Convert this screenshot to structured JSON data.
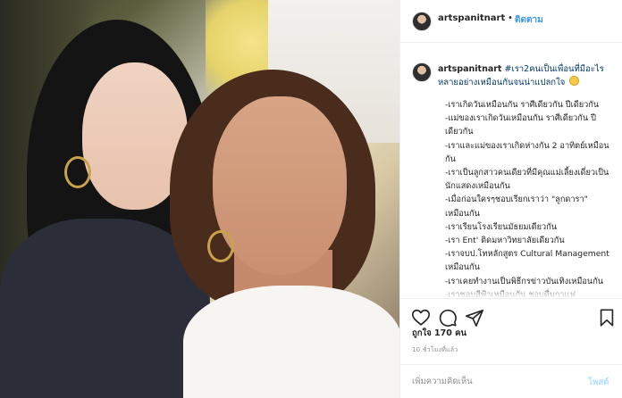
{
  "header": {
    "username": "artspanitnart",
    "separator": "•",
    "follow_label": "ติดตาม"
  },
  "caption": {
    "username": "artspanitnart",
    "hashtag_text": "#เรา2คนเป็นเพื่อนที่มีอะไรหลายอย่างเหมือนกันจนน่าแปลกใจ",
    "lines": [
      "-เราเกิดวันเหมือนกัน ราศีเดียวกัน ปีเดียวกัน",
      "-แม่ของเราเกิดวันเหมือนกัน ราศีเดียวกัน ปีเดียวกัน",
      "-เราและแม่ของเราเกิดห่างกัน 2 อาทิตย์เหมือนกัน",
      "-เราเป็นลูกสาวคนเดียวที่มีคุณแม่เลี้ยงเดี่ยวเป็นนักแสดงเหมือนกัน",
      "-เมื่อก่อนใครๆชอบเรียกเราว่า \"ลูกดารา\" เหมือนกัน",
      "-เราเรียนโรงเรียนมัธยมเดียวกัน",
      "-เรา Ent' ติดมหาวิทยาลัยเดียวกัน",
      "-เราจบป.โทหลักสูตร Cultural Management เหมือนกัน",
      "-เราเคยทำงานเป็นพิธีกรข่าวบันเทิงเหมือนกัน",
      "-เราชอบสีฟ้าเหมือนกัน ชอบดื่มกาแฟ"
    ]
  },
  "actions": {
    "like_icon": "heart-icon",
    "comment_icon": "comment-icon",
    "share_icon": "share-icon",
    "save_icon": "bookmark-icon"
  },
  "likes_text": "ถูกใจ 170 คน",
  "time_text": "10 ชั่วโมงที่แล้ว",
  "comment_box": {
    "placeholder": "เพิ่มความคิดเห็น",
    "post_label": "โพสต์"
  },
  "colors": {
    "link_blue": "#3897f0",
    "post_disabled": "#b2dffc",
    "border": "#efefef"
  }
}
